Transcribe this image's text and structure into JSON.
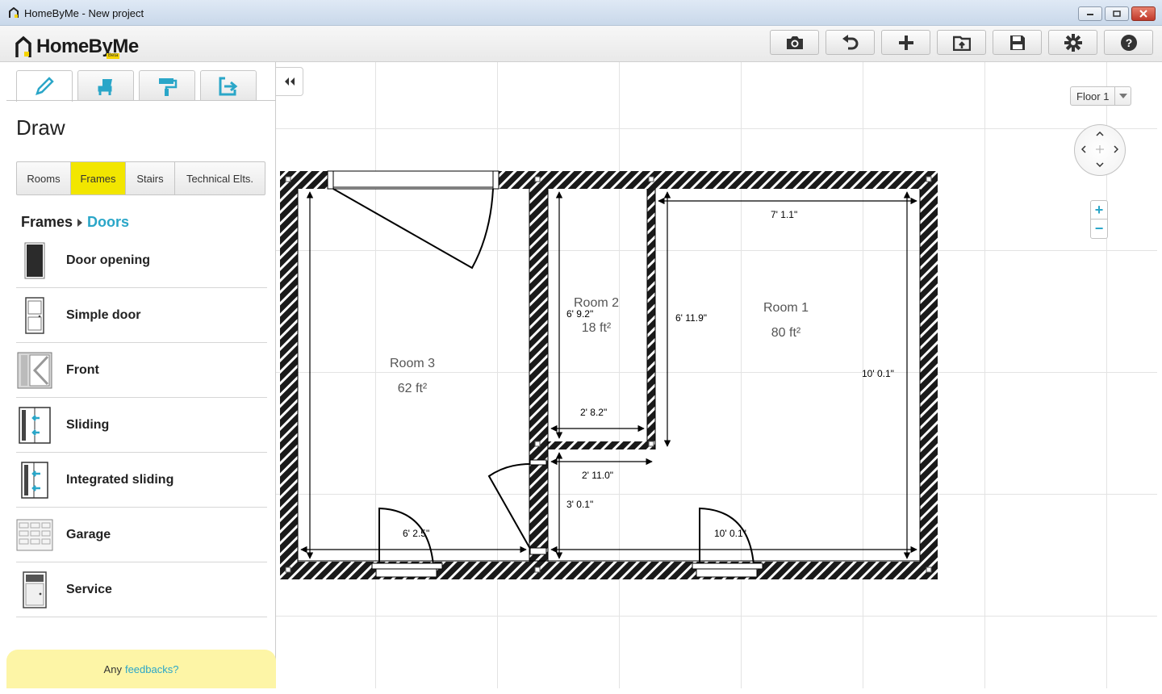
{
  "window": {
    "title": "HomeByMe - New project"
  },
  "header": {
    "logo_text": "HomeByMe",
    "beta_label": "Beta",
    "toolbar": [
      {
        "name": "camera-icon",
        "label": "Screenshot"
      },
      {
        "name": "undo-icon",
        "label": "Undo"
      },
      {
        "name": "plus-icon",
        "label": "New"
      },
      {
        "name": "open-project-icon",
        "label": "Open"
      },
      {
        "name": "save-icon",
        "label": "Save"
      },
      {
        "name": "gear-icon",
        "label": "Settings"
      },
      {
        "name": "help-icon",
        "label": "Help"
      }
    ]
  },
  "left_panel": {
    "tabs": [
      {
        "name": "pencil-icon",
        "active": true
      },
      {
        "name": "chair-icon",
        "active": false
      },
      {
        "name": "paint-roller-icon",
        "active": false
      },
      {
        "name": "export-icon",
        "active": false
      }
    ],
    "title": "Draw",
    "subtabs": [
      "Rooms",
      "Frames",
      "Stairs",
      "Technical Elts."
    ],
    "active_subtab": "Frames",
    "breadcrumb": {
      "parent": "Frames",
      "current": "Doors"
    },
    "doors": [
      {
        "label": "Door opening",
        "icon": "door-opening-icon"
      },
      {
        "label": "Simple door",
        "icon": "simple-door-icon"
      },
      {
        "label": "Front",
        "icon": "front-door-icon"
      },
      {
        "label": "Sliding",
        "icon": "sliding-door-icon"
      },
      {
        "label": "Integrated sliding",
        "icon": "integrated-sliding-door-icon"
      },
      {
        "label": "Garage",
        "icon": "garage-door-icon"
      },
      {
        "label": "Service",
        "icon": "service-door-icon"
      }
    ],
    "feedback": {
      "prefix": "Any",
      "link": "feedbacks?"
    }
  },
  "canvas": {
    "floor_select": "Floor 1",
    "zoom_in": "+",
    "zoom_out": "−",
    "rooms": [
      {
        "name": "Room 3",
        "area": "62 ft²"
      },
      {
        "name": "Room 2",
        "area": "18 ft²"
      },
      {
        "name": "Room 1",
        "area": "80 ft²"
      }
    ],
    "dimensions": {
      "room1_width_top": "7' 1.1\"",
      "room1_height_left": "6' 11.9\"",
      "room1_height_right": "10' 0.1\"",
      "room1_width_bottom": "10' 0.1\"",
      "room2_height": "6' 9.2\"",
      "room2_width": "2' 8.2\"",
      "corridor_width": "2' 11.0\"",
      "corridor_height": "3' 0.1\"",
      "room3_width": "6' 2.5\""
    }
  },
  "colors": {
    "accent": "#2aa6c8",
    "active_subtab": "#f2e600",
    "feedback_bg": "#fdf5a6"
  }
}
